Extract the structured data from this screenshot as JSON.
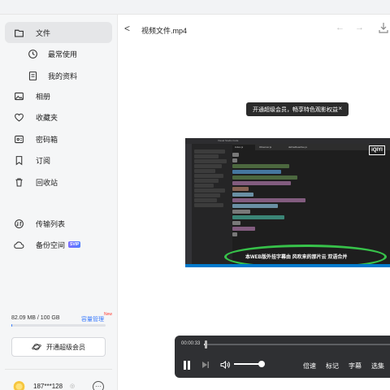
{
  "sidebar": {
    "items": [
      {
        "label": "文件",
        "icon": "file-icon"
      },
      {
        "label": "最常使用",
        "icon": "clock-icon"
      },
      {
        "label": "我的资料",
        "icon": "document-icon"
      },
      {
        "label": "相册",
        "icon": "image-icon"
      },
      {
        "label": "收藏夹",
        "icon": "heart-icon"
      },
      {
        "label": "密码箱",
        "icon": "safe-icon"
      },
      {
        "label": "订阅",
        "icon": "bookmark-icon"
      },
      {
        "label": "回收站",
        "icon": "trash-icon"
      },
      {
        "label": "传输列表",
        "icon": "transfer-icon"
      },
      {
        "label": "备份空间",
        "icon": "cloud-icon",
        "badge": "SVIP"
      }
    ],
    "storage": {
      "text": "82.09 MB / 100 GB",
      "manage_label": "容量管理",
      "new_tag": "New",
      "used_fraction": 0.0008
    },
    "vip_button_label": "开通超级会员",
    "user": {
      "name": "187***128",
      "badge": "◎",
      "more": "···"
    }
  },
  "header": {
    "title": "视频文件.mp4",
    "back": "<",
    "prev": "←",
    "next": "→"
  },
  "toast": {
    "text": "开通超级会员，畅享特色观影权益",
    "close": "×"
  },
  "video": {
    "watermark": "iQIYI",
    "subtitle": "本WEB版外挂字幕由 风吹来的那片云 双语合并",
    "window_title": "Visual Studio Code",
    "tabs": [
      "index.js",
      "Observer.js",
      "defineReactive.js"
    ]
  },
  "player": {
    "time": "00:00:33",
    "progress_fraction": 0.01,
    "volume_fraction": 1.0,
    "labels": {
      "speed": "倍速",
      "bookmark": "标记",
      "subtitle": "字幕",
      "episodes": "选集"
    }
  },
  "colors": {
    "accent": "#3a7bfd",
    "highlight_oval": "#37c24a",
    "player_bg": "#2f3033"
  }
}
